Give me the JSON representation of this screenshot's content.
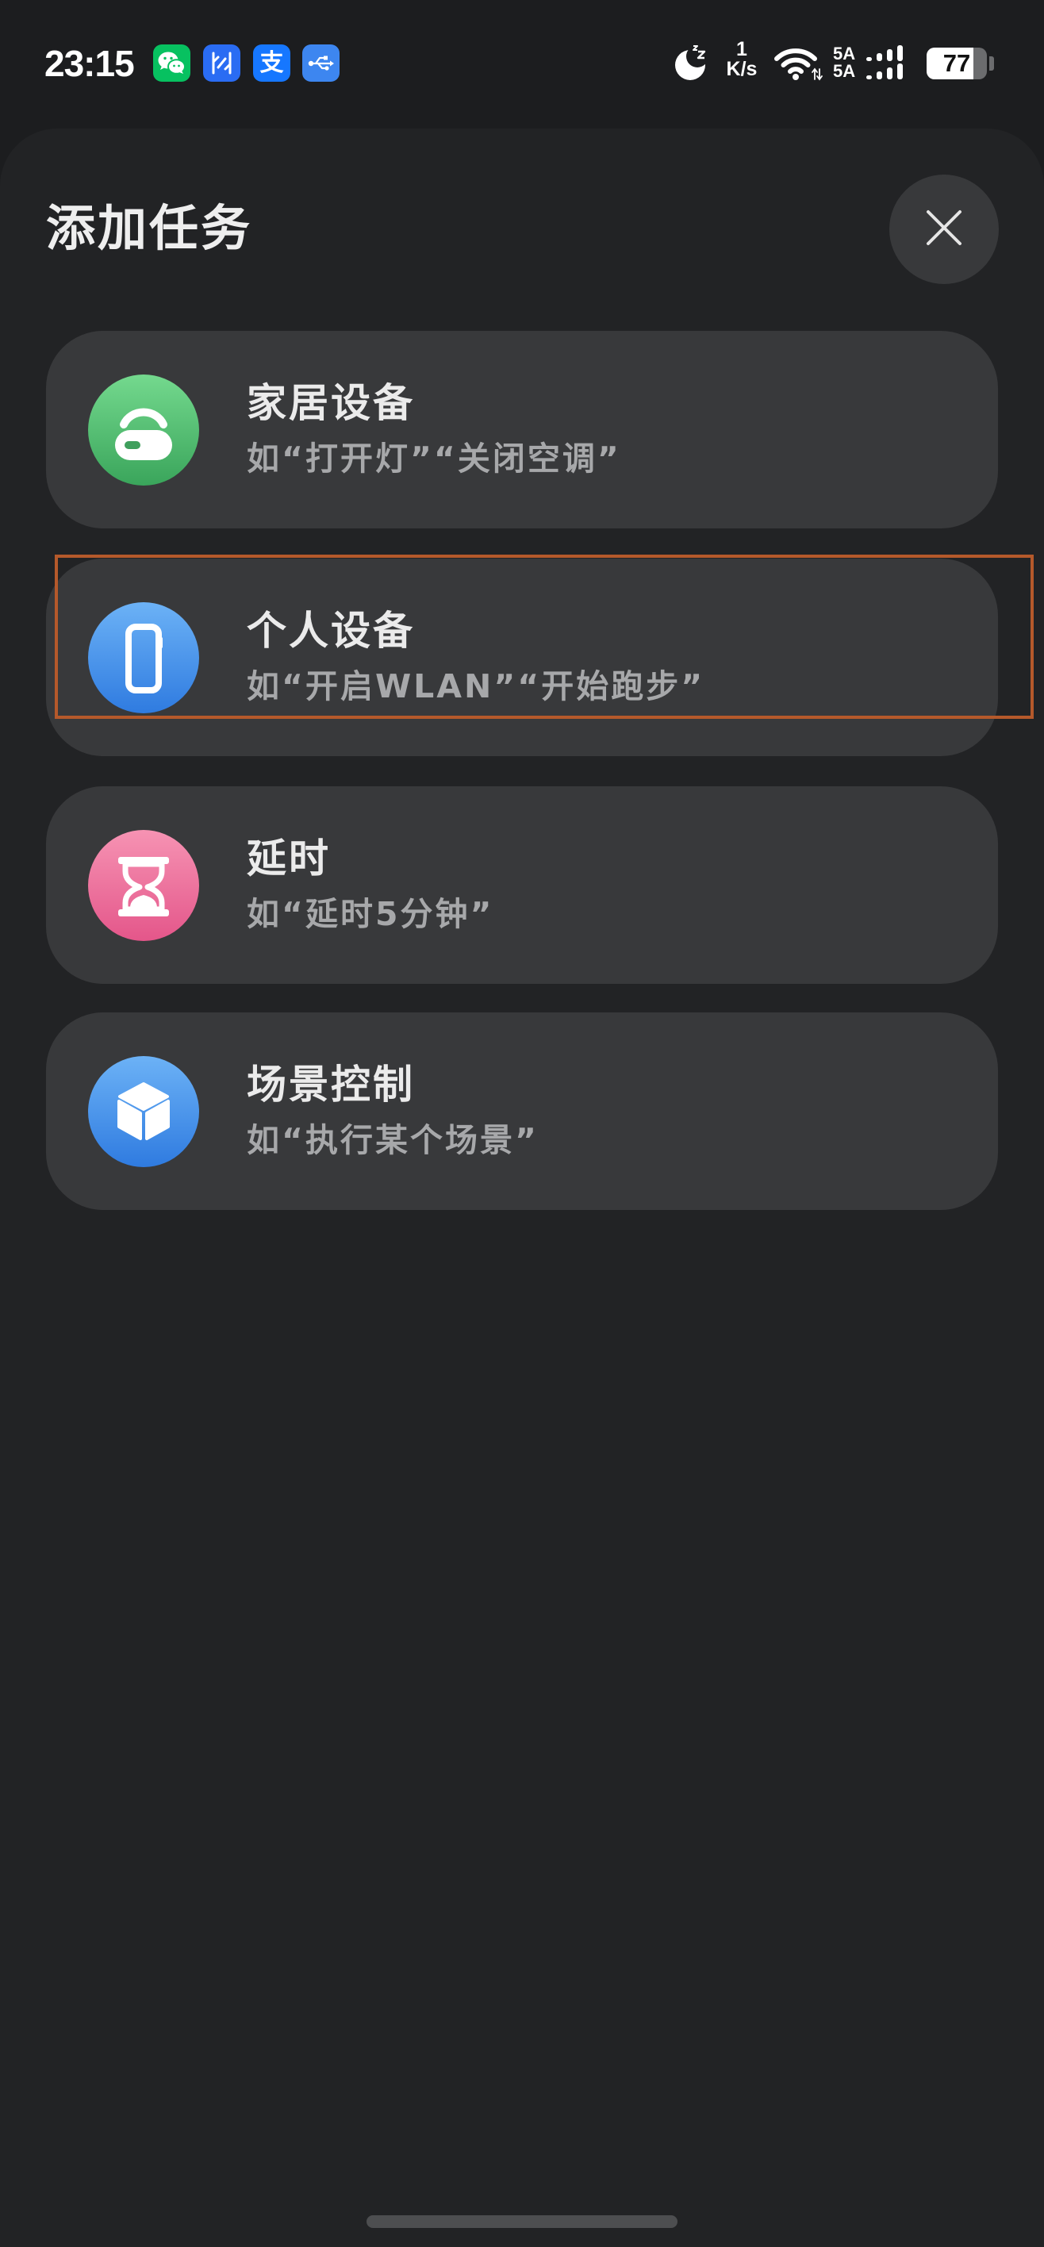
{
  "status_bar": {
    "time": "23:15",
    "notification_icons": [
      {
        "icon": "wechat-icon",
        "color": "#07c160"
      },
      {
        "icon": "app-icon",
        "color": "#2a6cf3"
      },
      {
        "icon": "alipay-icon",
        "color": "#1677ff",
        "glyph": "支"
      },
      {
        "icon": "usb-icon",
        "color": "#3d86f0"
      }
    ],
    "sleep_icon": "sleep-moon-icon",
    "net_speed": {
      "value": "1",
      "unit": "K/s"
    },
    "wifi_icon": "wifi-icon",
    "signal": [
      {
        "label": "5A"
      },
      {
        "label": "5A"
      }
    ],
    "battery": {
      "level_text": "77",
      "level": 0.77
    }
  },
  "sheet": {
    "title": "添加任务",
    "close_icon": "close-icon",
    "options": [
      {
        "title": "家居设备",
        "subtitle": "如“打开灯”“关闭空调”",
        "icon": "smart-home-device-icon",
        "icon_gradient": [
          "#74d98e",
          "#3aa55b"
        ]
      },
      {
        "title": "个人设备",
        "subtitle": "如“开启WLAN”“开始跑步”",
        "icon": "phone-icon",
        "icon_gradient": [
          "#6cb2f6",
          "#2f7be0"
        ]
      },
      {
        "title": "延时",
        "subtitle": "如“延时5分钟”",
        "icon": "hourglass-icon",
        "icon_gradient": [
          "#f693b3",
          "#e4568a"
        ]
      },
      {
        "title": "场景控制",
        "subtitle": "如“执行某个场景”",
        "icon": "cube-icon",
        "icon_gradient": [
          "#6cb2f6",
          "#2f7be0"
        ]
      }
    ]
  },
  "colors": {
    "background": "#1c1d1f",
    "sheet": "#222325",
    "card": "#38393b",
    "highlight_border": "#b5592b"
  }
}
